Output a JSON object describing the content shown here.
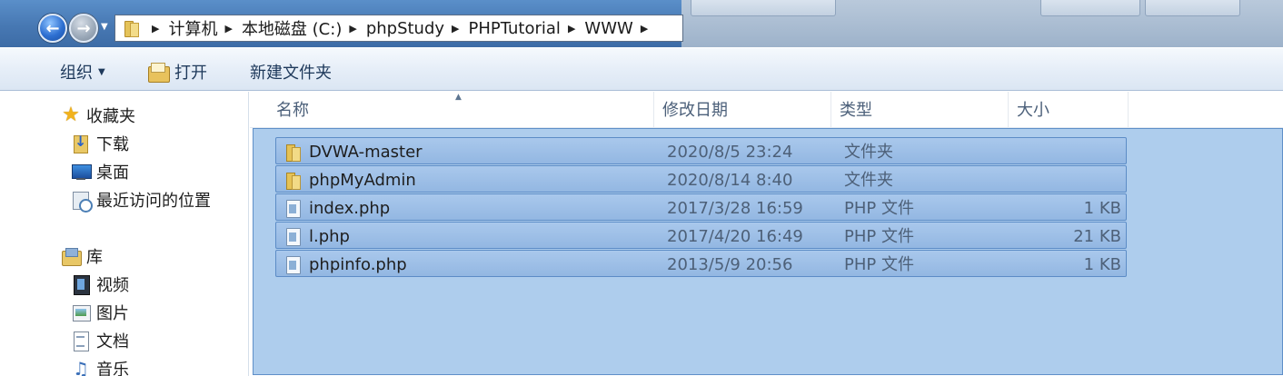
{
  "address": {
    "crumbs": [
      "计算机",
      "本地磁盘 (C:)",
      "phpStudy",
      "PHPTutorial",
      "WWW"
    ]
  },
  "toolbar": {
    "organize_label": "组织",
    "open_label": "打开",
    "new_folder_label": "新建文件夹"
  },
  "sidebar": {
    "favorites_label": "收藏夹",
    "favorites": [
      {
        "label": "下载",
        "icon": "downloads-folder-icon"
      },
      {
        "label": "桌面",
        "icon": "desktop-icon"
      },
      {
        "label": "最近访问的位置",
        "icon": "recent-places-icon"
      }
    ],
    "library_label": "库",
    "libraries": [
      {
        "label": "视频",
        "icon": "video-library-icon"
      },
      {
        "label": "图片",
        "icon": "pictures-library-icon"
      },
      {
        "label": "文档",
        "icon": "documents-library-icon"
      },
      {
        "label": "音乐",
        "icon": "music-library-icon"
      }
    ]
  },
  "columns": {
    "name": "名称",
    "modified": "修改日期",
    "type": "类型",
    "size": "大小"
  },
  "files": [
    {
      "name": "DVWA-master",
      "modified": "2020/8/5 23:24",
      "type": "文件夹",
      "size": "",
      "kind": "folder"
    },
    {
      "name": "phpMyAdmin",
      "modified": "2020/8/14 8:40",
      "type": "文件夹",
      "size": "",
      "kind": "folder"
    },
    {
      "name": "index.php",
      "modified": "2017/3/28 16:59",
      "type": "PHP 文件",
      "size": "1 KB",
      "kind": "file"
    },
    {
      "name": "l.php",
      "modified": "2017/4/20 16:49",
      "type": "PHP 文件",
      "size": "21 KB",
      "kind": "file"
    },
    {
      "name": "phpinfo.php",
      "modified": "2013/5/9 20:56",
      "type": "PHP 文件",
      "size": "1 KB",
      "kind": "file"
    }
  ],
  "colors": {
    "selection": "#a0c4ea",
    "selection_border": "#5f8fc8",
    "header_text": "#4c607a"
  }
}
